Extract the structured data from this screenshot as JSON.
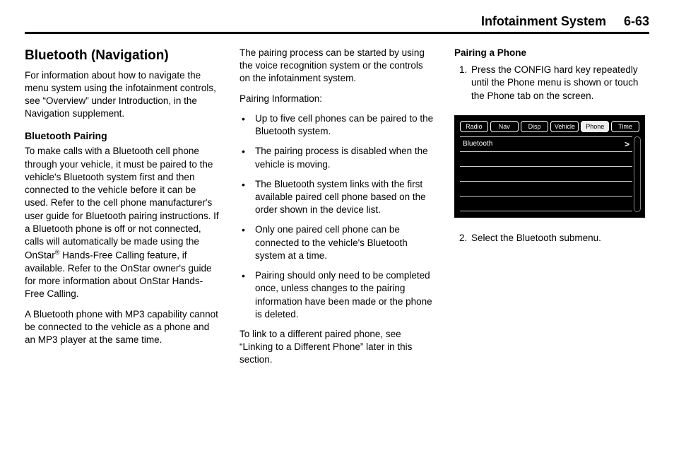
{
  "header": {
    "title": "Infotainment System",
    "pagenum": "6-63"
  },
  "col1": {
    "title": "Bluetooth (Navigation)",
    "intro": "For information about how to navigate the menu system using the infotainment controls, see “Overview” under Introduction, in the Navigation supplement.",
    "pairing_heading": "Bluetooth Pairing",
    "pairing_p1a": "To make calls with a Bluetooth cell phone through your vehicle, it must be paired to the vehicle's Bluetooth system first and then connected to the vehicle before it can be used. Refer to the cell phone manufacturer's user guide for Bluetooth pairing instructions. If a Bluetooth phone is off or not connected, calls will automatically be made using the OnStar",
    "pairing_sup": "®",
    "pairing_p1b": " Hands-Free Calling feature, if available. Refer to the OnStar owner's guide for more information about OnStar Hands-Free Calling.",
    "pairing_p2": "A Bluetooth phone with MP3 capability cannot be connected to the vehicle as a phone and an MP3 player at the same time."
  },
  "col2": {
    "p1": "The pairing process can be started by using the voice recognition system or the controls on the infotainment system.",
    "info_heading": "Pairing Information:",
    "bullets": [
      "Up to five cell phones can be paired to the Bluetooth system.",
      "The pairing process is disabled when the vehicle is moving.",
      "The Bluetooth system links with the first available paired cell phone based on the order shown in the device list.",
      "Only one paired cell phone can be connected to the vehicle's Bluetooth system at a time.",
      "Pairing should only need to be completed once, unless changes to the pairing information have been made or the phone is deleted."
    ],
    "p2": "To link to a different paired phone, see “Linking to a Different Phone” later in this section."
  },
  "col3": {
    "heading": "Pairing a Phone",
    "step1": "Press the CONFIG hard key repeatedly until the Phone menu is shown or touch the Phone tab on the screen.",
    "step2": "Select the Bluetooth submenu.",
    "screen": {
      "tabs": [
        "Radio",
        "Nav",
        "Disp",
        "Vehicle",
        "Phone",
        "Time"
      ],
      "active_tab_index": 4,
      "menu_item": "Bluetooth",
      "chevron": ">"
    }
  }
}
